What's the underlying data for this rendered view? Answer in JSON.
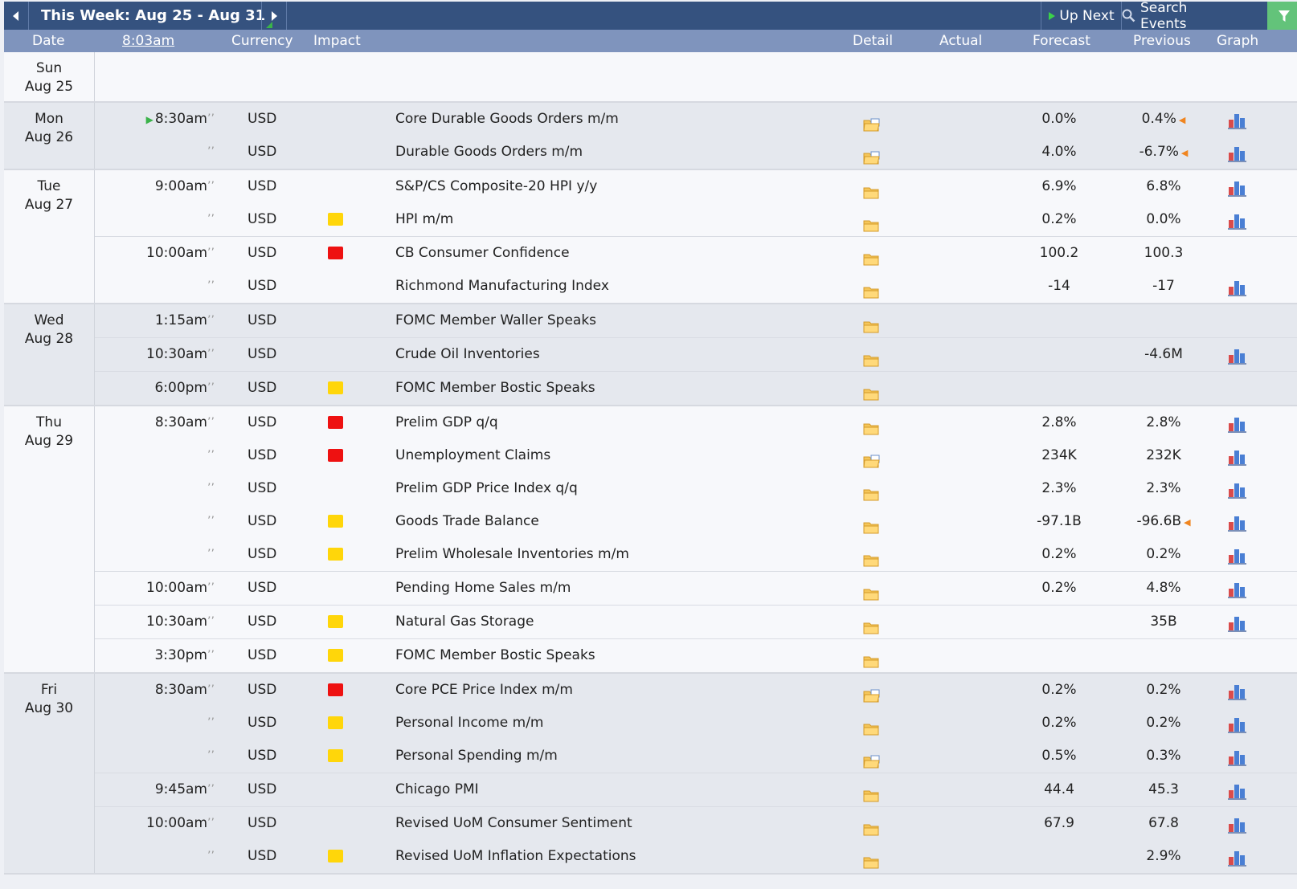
{
  "toolbar": {
    "title": "This Week: Aug 25 - Aug 31",
    "up_next": "Up Next",
    "search": "Search Events",
    "prev_icon": "caret-left-icon",
    "next_icon": "caret-right-icon",
    "filter_icon": "filter-icon",
    "accent_color": "#35527f"
  },
  "columns": {
    "date": "Date",
    "time": "8:03am",
    "currency": "Currency",
    "impact": "Impact",
    "detail": "Detail",
    "actual": "Actual",
    "forecast": "Forecast",
    "previous": "Previous",
    "graph": "Graph"
  },
  "impact_colors": {
    "high": "#e11111",
    "medium": "#f08520",
    "low": "#ffd60a"
  },
  "days": [
    {
      "weekday": "Sun",
      "date": "Aug 25",
      "events": []
    },
    {
      "weekday": "Mon",
      "date": "Aug 26",
      "events": [
        {
          "time": "8:30am",
          "next": true,
          "currency": "USD",
          "impact": "medium",
          "title": "Core Durable Goods Orders m/m",
          "detail": "folder-open",
          "actual": "",
          "forecast": "0.0%",
          "previous": "0.4%",
          "revised": true,
          "graph": true
        },
        {
          "time": "",
          "currency": "USD",
          "impact": "medium",
          "title": "Durable Goods Orders m/m",
          "detail": "folder-open",
          "actual": "",
          "forecast": "4.0%",
          "previous": "-6.7%",
          "revised": true,
          "graph": true
        }
      ]
    },
    {
      "weekday": "Tue",
      "date": "Aug 27",
      "events": [
        {
          "time": "9:00am",
          "currency": "USD",
          "impact": "medium",
          "title": "S&P/CS Composite-20 HPI y/y",
          "detail": "folder",
          "actual": "",
          "forecast": "6.9%",
          "previous": "6.8%",
          "graph": true
        },
        {
          "time": "",
          "currency": "USD",
          "impact": "low",
          "title": "HPI m/m",
          "detail": "folder",
          "actual": "",
          "forecast": "0.2%",
          "previous": "0.0%",
          "graph": true
        },
        {
          "time": "10:00am",
          "currency": "USD",
          "impact": "high",
          "title": "CB Consumer Confidence",
          "detail": "folder",
          "actual": "",
          "forecast": "100.2",
          "previous": "100.3",
          "graph": false
        },
        {
          "time": "",
          "currency": "USD",
          "impact": "medium",
          "title": "Richmond Manufacturing Index",
          "detail": "folder",
          "actual": "",
          "forecast": "-14",
          "previous": "-17",
          "graph": true
        }
      ]
    },
    {
      "weekday": "Wed",
      "date": "Aug 28",
      "events": [
        {
          "time": "1:15am",
          "currency": "USD",
          "impact": "medium",
          "title": "FOMC Member Waller Speaks",
          "detail": "folder",
          "actual": "",
          "forecast": "",
          "previous": "",
          "graph": false
        },
        {
          "time": "10:30am",
          "currency": "USD",
          "impact": "medium",
          "title": "Crude Oil Inventories",
          "detail": "folder",
          "actual": "",
          "forecast": "",
          "previous": "-4.6M",
          "graph": true
        },
        {
          "time": "6:00pm",
          "currency": "USD",
          "impact": "low",
          "title": "FOMC Member Bostic Speaks",
          "detail": "folder",
          "actual": "",
          "forecast": "",
          "previous": "",
          "graph": false
        }
      ]
    },
    {
      "weekday": "Thu",
      "date": "Aug 29",
      "events": [
        {
          "time": "8:30am",
          "currency": "USD",
          "impact": "high",
          "title": "Prelim GDP q/q",
          "detail": "folder",
          "actual": "",
          "forecast": "2.8%",
          "previous": "2.8%",
          "graph": true
        },
        {
          "time": "",
          "currency": "USD",
          "impact": "high",
          "title": "Unemployment Claims",
          "detail": "folder-open",
          "actual": "",
          "forecast": "234K",
          "previous": "232K",
          "graph": true
        },
        {
          "time": "",
          "currency": "USD",
          "impact": "medium",
          "title": "Prelim GDP Price Index q/q",
          "detail": "folder",
          "actual": "",
          "forecast": "2.3%",
          "previous": "2.3%",
          "graph": true
        },
        {
          "time": "",
          "currency": "USD",
          "impact": "low",
          "title": "Goods Trade Balance",
          "detail": "folder",
          "actual": "",
          "forecast": "-97.1B",
          "previous": "-96.6B",
          "revised": true,
          "graph": true
        },
        {
          "time": "",
          "currency": "USD",
          "impact": "low",
          "title": "Prelim Wholesale Inventories m/m",
          "detail": "folder",
          "actual": "",
          "forecast": "0.2%",
          "previous": "0.2%",
          "graph": true
        },
        {
          "time": "10:00am",
          "currency": "USD",
          "impact": "medium",
          "title": "Pending Home Sales m/m",
          "detail": "folder",
          "actual": "",
          "forecast": "0.2%",
          "previous": "4.8%",
          "graph": true
        },
        {
          "time": "10:30am",
          "currency": "USD",
          "impact": "low",
          "title": "Natural Gas Storage",
          "detail": "folder",
          "actual": "",
          "forecast": "",
          "previous": "35B",
          "graph": true
        },
        {
          "time": "3:30pm",
          "currency": "USD",
          "impact": "low",
          "title": "FOMC Member Bostic Speaks",
          "detail": "folder",
          "actual": "",
          "forecast": "",
          "previous": "",
          "graph": false
        }
      ]
    },
    {
      "weekday": "Fri",
      "date": "Aug 30",
      "events": [
        {
          "time": "8:30am",
          "currency": "USD",
          "impact": "high",
          "title": "Core PCE Price Index m/m",
          "detail": "folder-open",
          "actual": "",
          "forecast": "0.2%",
          "previous": "0.2%",
          "graph": true
        },
        {
          "time": "",
          "currency": "USD",
          "impact": "low",
          "title": "Personal Income m/m",
          "detail": "folder",
          "actual": "",
          "forecast": "0.2%",
          "previous": "0.2%",
          "graph": true
        },
        {
          "time": "",
          "currency": "USD",
          "impact": "low",
          "title": "Personal Spending m/m",
          "detail": "folder-open",
          "actual": "",
          "forecast": "0.5%",
          "previous": "0.3%",
          "graph": true
        },
        {
          "time": "9:45am",
          "currency": "USD",
          "impact": "medium",
          "title": "Chicago PMI",
          "detail": "folder",
          "actual": "",
          "forecast": "44.4",
          "previous": "45.3",
          "graph": true
        },
        {
          "time": "10:00am",
          "currency": "USD",
          "impact": "medium",
          "title": "Revised UoM Consumer Sentiment",
          "detail": "folder",
          "actual": "",
          "forecast": "67.9",
          "previous": "67.8",
          "graph": true
        },
        {
          "time": "",
          "currency": "USD",
          "impact": "low",
          "title": "Revised UoM Inflation Expectations",
          "detail": "folder",
          "actual": "",
          "forecast": "",
          "previous": "2.9%",
          "graph": true
        }
      ]
    }
  ]
}
